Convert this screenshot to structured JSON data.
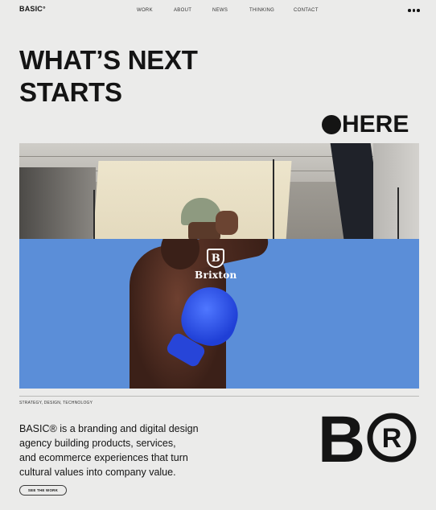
{
  "nav": {
    "logo": "BASIC°",
    "links": [
      "WORK",
      "ABOUT",
      "NEWS",
      "THINKING",
      "CONTACT"
    ],
    "menu_icon": "more-dots-icon"
  },
  "hero": {
    "title_lines": [
      "WHAT’S NEXT",
      "STARTS"
    ],
    "here": "HERE"
  },
  "media": {
    "logo_text": "Brixton",
    "logo_initial": "B"
  },
  "about": {
    "tags": "STRATEGY, DESIGN, TECHNOLOGY",
    "intro_lines": [
      "BASIC® is a branding and digital design",
      "agency building products, services,",
      "and ecommerce experiences that turn",
      "cultural values into company value."
    ],
    "cta_label": "SEE THE WORK",
    "mark_letter": "B",
    "mark_symbol": "R"
  },
  "colors": {
    "background": "#ebebea",
    "ink": "#141414",
    "sky_blue": "#5b8ed8",
    "glove_blue": "#1f3fd6"
  }
}
